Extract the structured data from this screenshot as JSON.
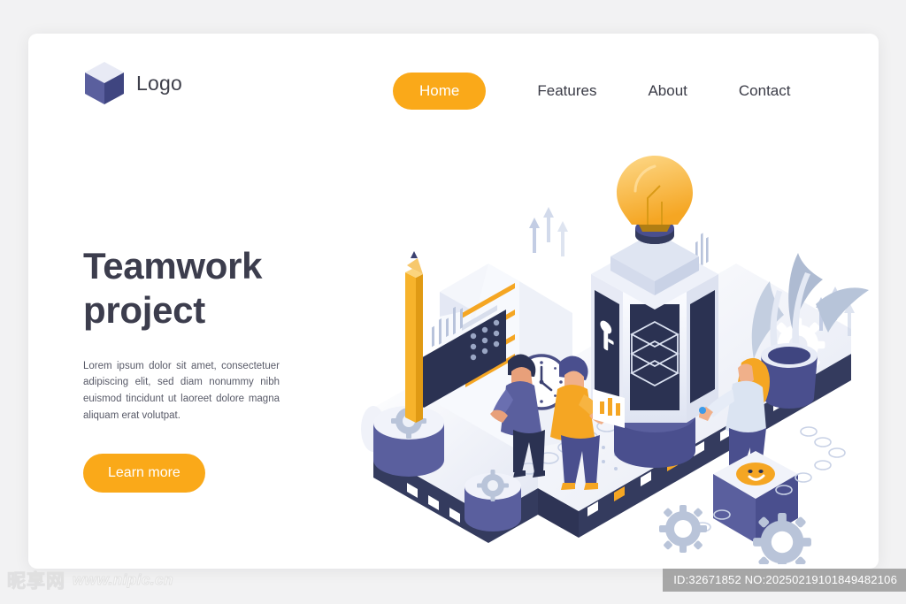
{
  "header": {
    "logo": {
      "icon": "cube-logo-icon",
      "text": "Logo"
    },
    "nav": [
      {
        "label": "Home",
        "active": true
      },
      {
        "label": "Features",
        "active": false
      },
      {
        "label": "About",
        "active": false
      },
      {
        "label": "Contact",
        "active": false
      }
    ]
  },
  "hero": {
    "headline_line1": "Teamwork",
    "headline_line2": "project",
    "paragraph": "Lorem ipsum dolor sit amet, consectetuer adipiscing elit, sed diam nonummy nibh euismod tincidunt ut laoreet dolore magna aliquam erat volutpat.",
    "cta_label": "Learn more",
    "illustration_name": "isometric-teamwork-illustration"
  },
  "watermark": {
    "site_cn": "昵享网",
    "site_url": "www.nipic.cn",
    "id_text": "ID:32671852 NO:20250219101849482106"
  },
  "colors": {
    "accent_orange": "#faa919",
    "heading_navy": "#3c3d4d",
    "body_gray": "#585a68",
    "deep_navy": "#343b5e",
    "purple": "#5a5f9e",
    "light_panel": "#eef0f8",
    "steel_blue": "#b7c2d6",
    "page_bg": "#f2f2f3",
    "card_bg": "#ffffff"
  }
}
